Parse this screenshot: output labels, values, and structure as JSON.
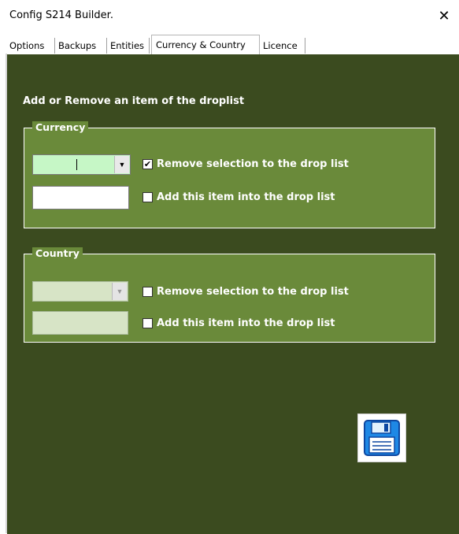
{
  "window": {
    "title": "Config S214 Builder.",
    "close_glyph": "✕"
  },
  "tabs": [
    {
      "label": "Options"
    },
    {
      "label": "Backups"
    },
    {
      "label": "Entities"
    },
    {
      "label": "Currency & Country",
      "active": true
    },
    {
      "label": "Licence"
    }
  ],
  "main": {
    "heading": "Add or Remove an item of the droplist",
    "currency": {
      "title": "Currency",
      "combo_value": "",
      "remove_label": "Remove selection to the drop list",
      "remove_checked": "✔",
      "add_value": "",
      "add_label": "Add this item into the drop list"
    },
    "country": {
      "title": "Country",
      "combo_value": "",
      "remove_label": "Remove selection to the drop list",
      "add_value": "",
      "add_label": "Add this item into the drop list"
    },
    "save_icon": "floppy-disk-icon"
  },
  "colors": {
    "panel_bg": "#3b4b1f",
    "group_bg": "#6a8a3a",
    "currency_combo_bg": "#c6f7c6",
    "country_field_bg": "#d7e4c6"
  }
}
